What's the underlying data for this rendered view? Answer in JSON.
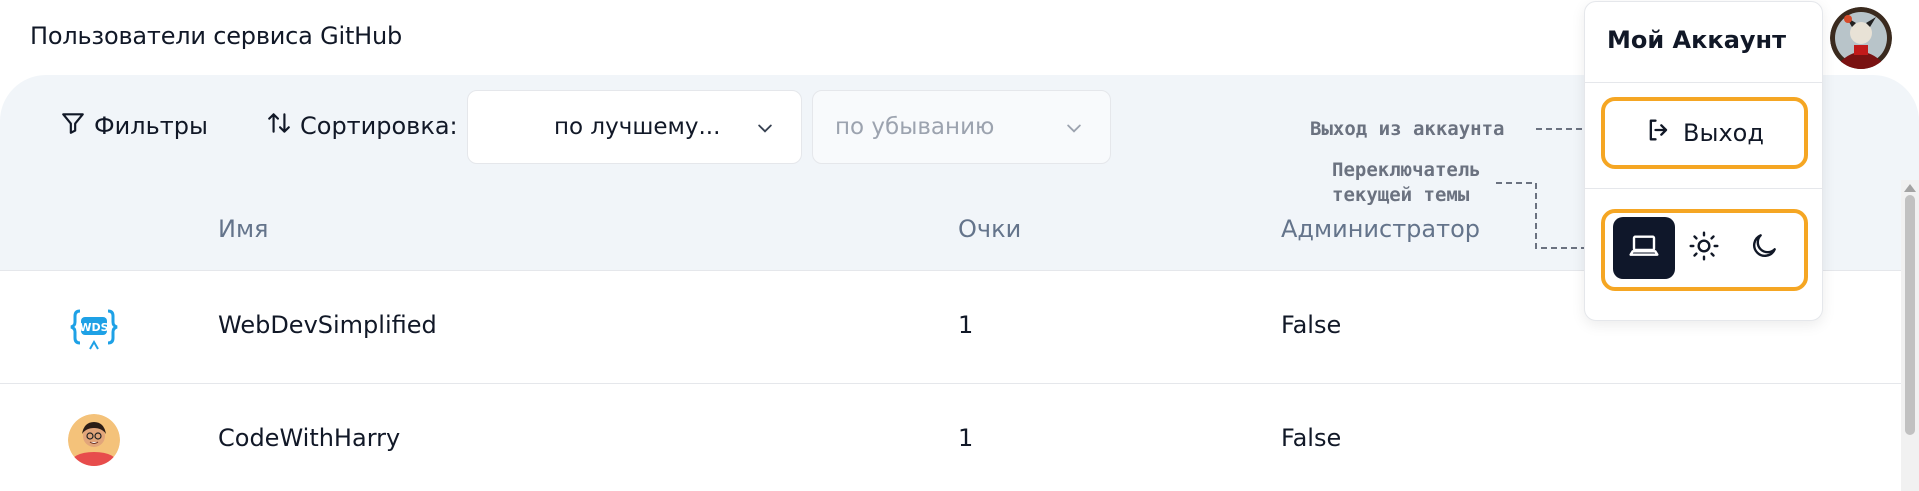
{
  "page": {
    "title": "Пользователи сервиса GitHub"
  },
  "toolbar": {
    "filters_label": "Фильтры",
    "sort_label": "Сортировка:",
    "sort_by": "по лучшему...",
    "sort_order": "по убыванию"
  },
  "table": {
    "columns": [
      "Имя",
      "Очки",
      "Администратор"
    ],
    "rows": [
      {
        "avatar": "wds-logo",
        "name": "WebDevSimplified",
        "points": "1",
        "admin": "False"
      },
      {
        "avatar": "user-photo",
        "name": "CodeWithHarry",
        "points": "1",
        "admin": "False"
      }
    ]
  },
  "account_menu": {
    "title": "Мой Аккаунт",
    "logout_label": "Выход",
    "theme_options": [
      "system-laptop-icon",
      "light-sun-icon",
      "dark-moon-icon"
    ],
    "active_theme": "system"
  },
  "annotations": {
    "logout": "Выход из аккаунта",
    "theme": "Переключатель\nтекущей темы"
  },
  "colors": {
    "accent_outline": "#f5a623",
    "active_theme_bg": "#0f172a",
    "panel_bg": "#f1f5f9",
    "wds_blue": "#1ea1e6"
  }
}
